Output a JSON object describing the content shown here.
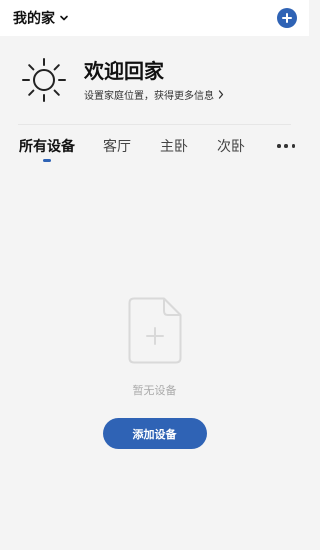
{
  "header": {
    "home_name": "我的家",
    "icons": {
      "dropdown": "chevron-down-icon",
      "add": "add-circle-icon"
    },
    "accent_color": "#2f63b5"
  },
  "welcome": {
    "title": "欢迎回家",
    "subtitle": "设置家庭位置，获得更多信息",
    "icons": {
      "weather": "sun-icon",
      "arrow": "chevron-right-icon"
    }
  },
  "tabs": {
    "items": [
      {
        "label": "所有设备",
        "active": true
      },
      {
        "label": "客厅",
        "active": false
      },
      {
        "label": "主卧",
        "active": false
      },
      {
        "label": "次卧",
        "active": false
      }
    ],
    "more_icon": "more-horizontal-icon"
  },
  "empty_state": {
    "icon": "add-file-icon",
    "message": "暂无设备",
    "button_label": "添加设备"
  }
}
